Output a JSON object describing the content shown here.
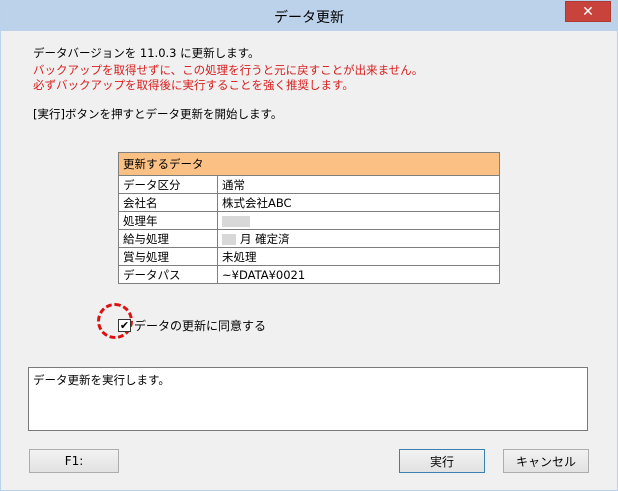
{
  "window": {
    "title": "データ更新",
    "close_glyph": "✕"
  },
  "messages": {
    "line1": "データバージョンを 11.0.3 に更新します。",
    "warning1": "バックアップを取得せずに、この処理を行うと元に戻すことが出来ません。",
    "warning2": "必ずバックアップを取得後に実行することを強く推奨します。",
    "instruction": "[実行]ボタンを押すとデータ更新を開始します。"
  },
  "table": {
    "header": "更新するデータ",
    "rows": [
      {
        "key": "データ区分",
        "value": "通常"
      },
      {
        "key": "会社名",
        "value": "株式会社ABC"
      },
      {
        "key": "処理年",
        "value": ""
      },
      {
        "key": "給与処理",
        "value": "月 確定済"
      },
      {
        "key": "賞与処理",
        "value": "未処理"
      },
      {
        "key": "データパス",
        "value": "~¥DATA¥0021"
      }
    ]
  },
  "agree": {
    "label": "データの更新に同意する",
    "checked": true,
    "check_glyph": "✔"
  },
  "log": {
    "text": "データ更新を実行します。"
  },
  "buttons": {
    "f1": "F1:",
    "execute": "実行",
    "cancel": "キャンセル"
  },
  "colors": {
    "warning": "#d81e1e",
    "table_header": "#fbc184",
    "close": "#c7433b"
  }
}
